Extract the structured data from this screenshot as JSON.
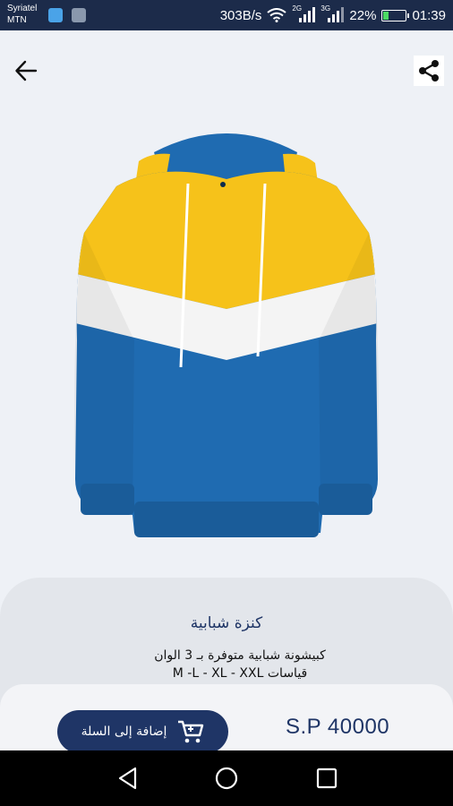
{
  "status_bar": {
    "carrier_line1": "Syriatel",
    "carrier_line2": "MTN",
    "net_speed": "303B/s",
    "battery": "22%",
    "battery_level": 0.22,
    "time": "01:39",
    "signal_labels": [
      "2G",
      "3G"
    ]
  },
  "product": {
    "title": "كنزة شبابية",
    "description_line1": "كبيشونة شبابية متوفرة بـ 3 الوان",
    "description_line2": "قياسات M -L - XL - XXL",
    "price": "S.P 40000",
    "add_to_cart_label": "إضافة إلى السلة"
  },
  "colors": {
    "primary": "#1f3566",
    "hoodie_yellow": "#f6c21a",
    "hoodie_blue": "#1f6bb1",
    "hoodie_white": "#f4f4f4"
  },
  "icons": {
    "back": "arrow-left-icon",
    "share": "share-icon",
    "cart": "cart-icon",
    "nav_back": "triangle-back-icon",
    "nav_home": "circle-home-icon",
    "nav_recents": "square-recents-icon"
  }
}
